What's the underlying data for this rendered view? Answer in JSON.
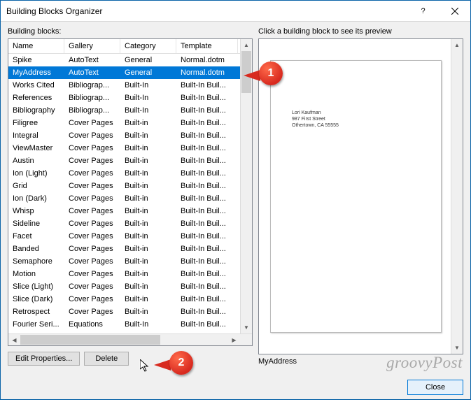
{
  "title": "Building Blocks Organizer",
  "labels": {
    "building_blocks": "Building blocks:",
    "preview_hint": "Click a building block to see its preview",
    "edit_properties": "Edit Properties...",
    "delete": "Delete",
    "close": "Close"
  },
  "columns": {
    "name": "Name",
    "gallery": "Gallery",
    "category": "Category",
    "template": "Template"
  },
  "selected_index": 1,
  "rows": [
    {
      "name": "Spike",
      "gallery": "AutoText",
      "category": "General",
      "template": "Normal.dotm"
    },
    {
      "name": "MyAddress",
      "gallery": "AutoText",
      "category": "General",
      "template": "Normal.dotm"
    },
    {
      "name": "Works Cited",
      "gallery": "Bibliograp...",
      "category": "Built-In",
      "template": "Built-In Buil..."
    },
    {
      "name": "References",
      "gallery": "Bibliograp...",
      "category": "Built-In",
      "template": "Built-In Buil..."
    },
    {
      "name": "Bibliography",
      "gallery": "Bibliograp...",
      "category": "Built-In",
      "template": "Built-In Buil..."
    },
    {
      "name": "Filigree",
      "gallery": "Cover Pages",
      "category": "Built-in",
      "template": "Built-In Buil..."
    },
    {
      "name": "Integral",
      "gallery": "Cover Pages",
      "category": "Built-in",
      "template": "Built-In Buil..."
    },
    {
      "name": "ViewMaster",
      "gallery": "Cover Pages",
      "category": "Built-in",
      "template": "Built-In Buil..."
    },
    {
      "name": "Austin",
      "gallery": "Cover Pages",
      "category": "Built-in",
      "template": "Built-In Buil..."
    },
    {
      "name": "Ion (Light)",
      "gallery": "Cover Pages",
      "category": "Built-in",
      "template": "Built-In Buil..."
    },
    {
      "name": "Grid",
      "gallery": "Cover Pages",
      "category": "Built-in",
      "template": "Built-In Buil..."
    },
    {
      "name": "Ion (Dark)",
      "gallery": "Cover Pages",
      "category": "Built-in",
      "template": "Built-In Buil..."
    },
    {
      "name": "Whisp",
      "gallery": "Cover Pages",
      "category": "Built-in",
      "template": "Built-In Buil..."
    },
    {
      "name": "Sideline",
      "gallery": "Cover Pages",
      "category": "Built-in",
      "template": "Built-In Buil..."
    },
    {
      "name": "Facet",
      "gallery": "Cover Pages",
      "category": "Built-in",
      "template": "Built-In Buil..."
    },
    {
      "name": "Banded",
      "gallery": "Cover Pages",
      "category": "Built-in",
      "template": "Built-In Buil..."
    },
    {
      "name": "Semaphore",
      "gallery": "Cover Pages",
      "category": "Built-in",
      "template": "Built-In Buil..."
    },
    {
      "name": "Motion",
      "gallery": "Cover Pages",
      "category": "Built-in",
      "template": "Built-In Buil..."
    },
    {
      "name": "Slice (Light)",
      "gallery": "Cover Pages",
      "category": "Built-in",
      "template": "Built-In Buil..."
    },
    {
      "name": "Slice (Dark)",
      "gallery": "Cover Pages",
      "category": "Built-in",
      "template": "Built-In Buil..."
    },
    {
      "name": "Retrospect",
      "gallery": "Cover Pages",
      "category": "Built-in",
      "template": "Built-In Buil..."
    },
    {
      "name": "Fourier Seri...",
      "gallery": "Equations",
      "category": "Built-In",
      "template": "Built-In Buil..."
    }
  ],
  "preview": {
    "selected_name": "MyAddress",
    "lines": [
      "Lori Kaufman",
      "987 First Street",
      "Othertown, CA 55555"
    ]
  },
  "callouts": {
    "c1": "1",
    "c2": "2"
  },
  "watermark": "groovyPost"
}
